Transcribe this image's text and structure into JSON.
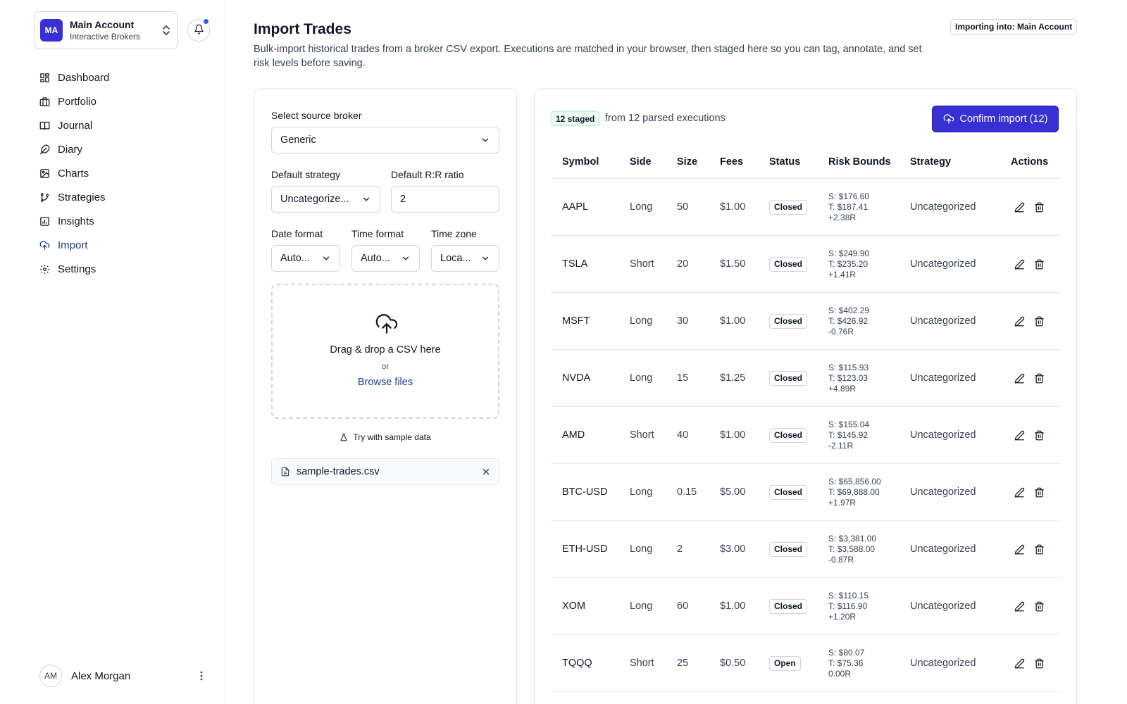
{
  "account": {
    "initials": "MA",
    "name": "Main Account",
    "broker": "Interactive Brokers"
  },
  "nav": [
    {
      "label": "Dashboard",
      "icon": "grid-icon"
    },
    {
      "label": "Portfolio",
      "icon": "briefcase-icon"
    },
    {
      "label": "Journal",
      "icon": "book-icon"
    },
    {
      "label": "Diary",
      "icon": "feather-icon"
    },
    {
      "label": "Charts",
      "icon": "image-chart-icon"
    },
    {
      "label": "Strategies",
      "icon": "git-branch-icon"
    },
    {
      "label": "Insights",
      "icon": "bar-chart-icon"
    },
    {
      "label": "Import",
      "icon": "cloud-upload-icon",
      "active": true
    },
    {
      "label": "Settings",
      "icon": "gear-icon"
    }
  ],
  "user": {
    "initials": "AM",
    "name": "Alex Morgan"
  },
  "header": {
    "title": "Import Trades",
    "description": "Bulk-import historical trades from a broker CSV export. Executions are matched in your browser, then staged here so you can tag, annotate, and set risk levels before saving.",
    "importing_badge": "Importing into: Main Account"
  },
  "form": {
    "broker_label": "Select source broker",
    "broker_value": "Generic",
    "strategy_label": "Default strategy",
    "strategy_value": "Uncategorize...",
    "rr_label": "Default R:R ratio",
    "rr_value": "2",
    "date_label": "Date format",
    "date_value": "Auto...",
    "time_label": "Time format",
    "time_value": "Auto...",
    "tz_label": "Time zone",
    "tz_value": "Loca...",
    "drop_title": "Drag & drop a CSV here",
    "drop_or": "or",
    "browse": "Browse files",
    "sample": "Try with sample data",
    "file_name": "sample-trades.csv"
  },
  "staged": {
    "badge": "12 staged",
    "text": "from 12 parsed executions",
    "confirm": "Confirm import (12)"
  },
  "table": {
    "headers": {
      "symbol": "Symbol",
      "side": "Side",
      "size": "Size",
      "fees": "Fees",
      "status": "Status",
      "risk": "Risk Bounds",
      "strategy": "Strategy",
      "actions": "Actions"
    },
    "rows": [
      {
        "symbol": "AAPL",
        "side": "Long",
        "size": "50",
        "fees": "$1.00",
        "status": "Closed",
        "stop": "S: $176.60",
        "target": "T: $187.41",
        "r": "+2.38R",
        "strategy": "Uncategorized"
      },
      {
        "symbol": "TSLA",
        "side": "Short",
        "size": "20",
        "fees": "$1.50",
        "status": "Closed",
        "stop": "S: $249.90",
        "target": "T: $235.20",
        "r": "+1.41R",
        "strategy": "Uncategorized"
      },
      {
        "symbol": "MSFT",
        "side": "Long",
        "size": "30",
        "fees": "$1.00",
        "status": "Closed",
        "stop": "S: $402.29",
        "target": "T: $426.92",
        "r": "-0.76R",
        "strategy": "Uncategorized"
      },
      {
        "symbol": "NVDA",
        "side": "Long",
        "size": "15",
        "fees": "$1.25",
        "status": "Closed",
        "stop": "S: $115.93",
        "target": "T: $123.03",
        "r": "+4.89R",
        "strategy": "Uncategorized"
      },
      {
        "symbol": "AMD",
        "side": "Short",
        "size": "40",
        "fees": "$1.00",
        "status": "Closed",
        "stop": "S: $155.04",
        "target": "T: $145.92",
        "r": "-2.11R",
        "strategy": "Uncategorized"
      },
      {
        "symbol": "BTC-USD",
        "side": "Long",
        "size": "0.15",
        "fees": "$5.00",
        "status": "Closed",
        "stop": "S: $65,856.00",
        "target": "T: $69,888.00",
        "r": "+1.97R",
        "strategy": "Uncategorized"
      },
      {
        "symbol": "ETH-USD",
        "side": "Long",
        "size": "2",
        "fees": "$3.00",
        "status": "Closed",
        "stop": "S: $3,381.00",
        "target": "T: $3,588.00",
        "r": "-0.87R",
        "strategy": "Uncategorized"
      },
      {
        "symbol": "XOM",
        "side": "Long",
        "size": "60",
        "fees": "$1.00",
        "status": "Closed",
        "stop": "S: $110.15",
        "target": "T: $116.90",
        "r": "+1.20R",
        "strategy": "Uncategorized"
      },
      {
        "symbol": "TQQQ",
        "side": "Short",
        "size": "25",
        "fees": "$0.50",
        "status": "Open",
        "stop": "S: $80.07",
        "target": "T: $75.36",
        "r": "0.00R",
        "strategy": "Uncategorized"
      }
    ]
  },
  "colors": {
    "accent": "#3730d4",
    "notification_dot": "#2563eb",
    "staged_bg": "#ecfdf5"
  }
}
